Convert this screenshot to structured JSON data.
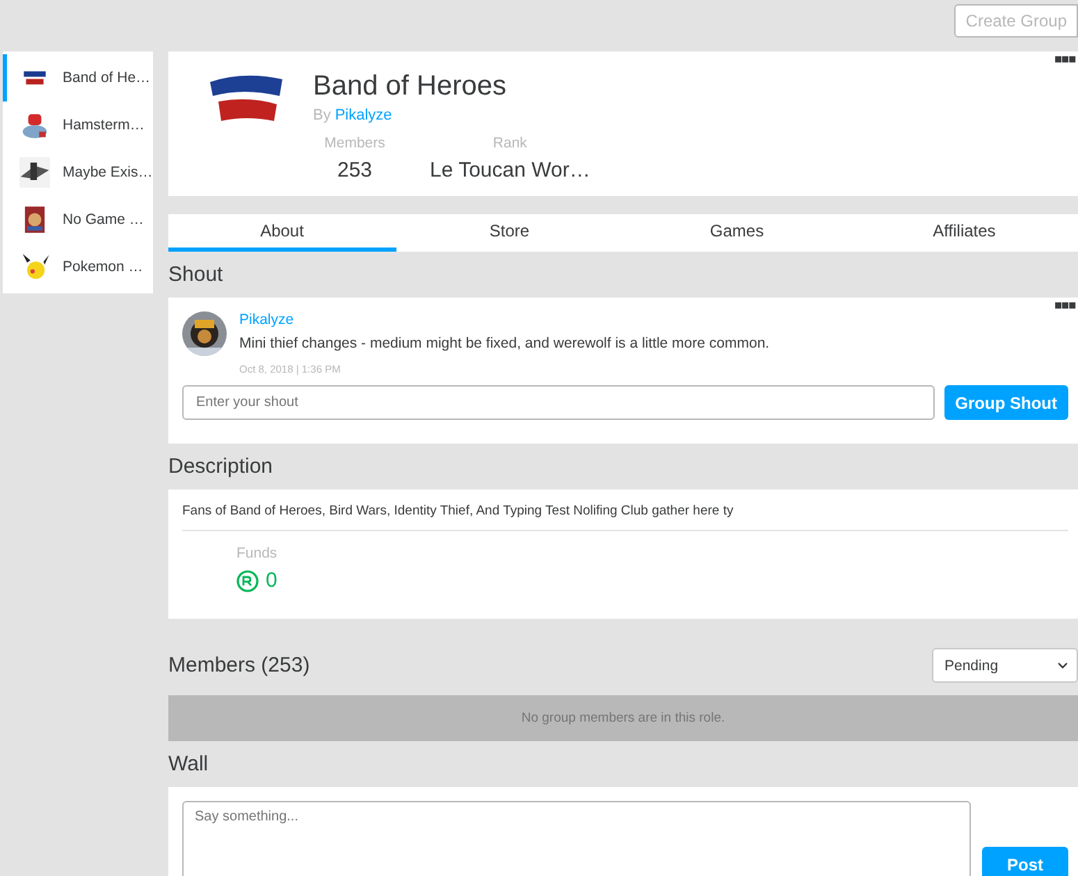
{
  "top_bar": {
    "create_button": "Create Group"
  },
  "sidebar": {
    "items": [
      {
        "name": "Band of He…",
        "selected": true,
        "kind": "logo"
      },
      {
        "name": "Hamsterm…",
        "selected": false,
        "kind": "creature"
      },
      {
        "name": "Maybe Exis…",
        "selected": false,
        "kind": "sketch"
      },
      {
        "name": "No Game …",
        "selected": false,
        "kind": "cover"
      },
      {
        "name": "Pokemon …",
        "selected": false,
        "kind": "mascot"
      }
    ]
  },
  "group": {
    "title": "Band of Heroes",
    "by_label": "By",
    "owner": "Pikalyze",
    "stats": [
      {
        "label": "Members",
        "value": "253"
      },
      {
        "label": "Rank",
        "value": "Le Toucan Wor…"
      }
    ],
    "more": "▪▪▪"
  },
  "tabs": [
    {
      "label": "About",
      "selected": true
    },
    {
      "label": "Store",
      "selected": false
    },
    {
      "label": "Games",
      "selected": false
    },
    {
      "label": "Affiliates",
      "selected": false
    }
  ],
  "shout": {
    "heading": "Shout",
    "author": "Pikalyze",
    "message": "Mini thief changes - medium might be fixed, and werewolf is a little more common.",
    "date": "Oct 8, 2018 | 1:36 PM",
    "more": "▪▪▪",
    "placeholder": "Enter your shout",
    "button": "Group Shout"
  },
  "description": {
    "heading": "Description",
    "text": "Fans of Band of Heroes, Bird Wars, Identity Thief, And Typing Test Nolifing Club gather here ty",
    "funds_label": "Funds",
    "funds_value": "0"
  },
  "members": {
    "heading": "Members (253)",
    "role": "Pending",
    "empty_message": "No group members are in this role."
  },
  "wall": {
    "heading": "Wall",
    "placeholder": "Say something...",
    "button": "Post"
  }
}
